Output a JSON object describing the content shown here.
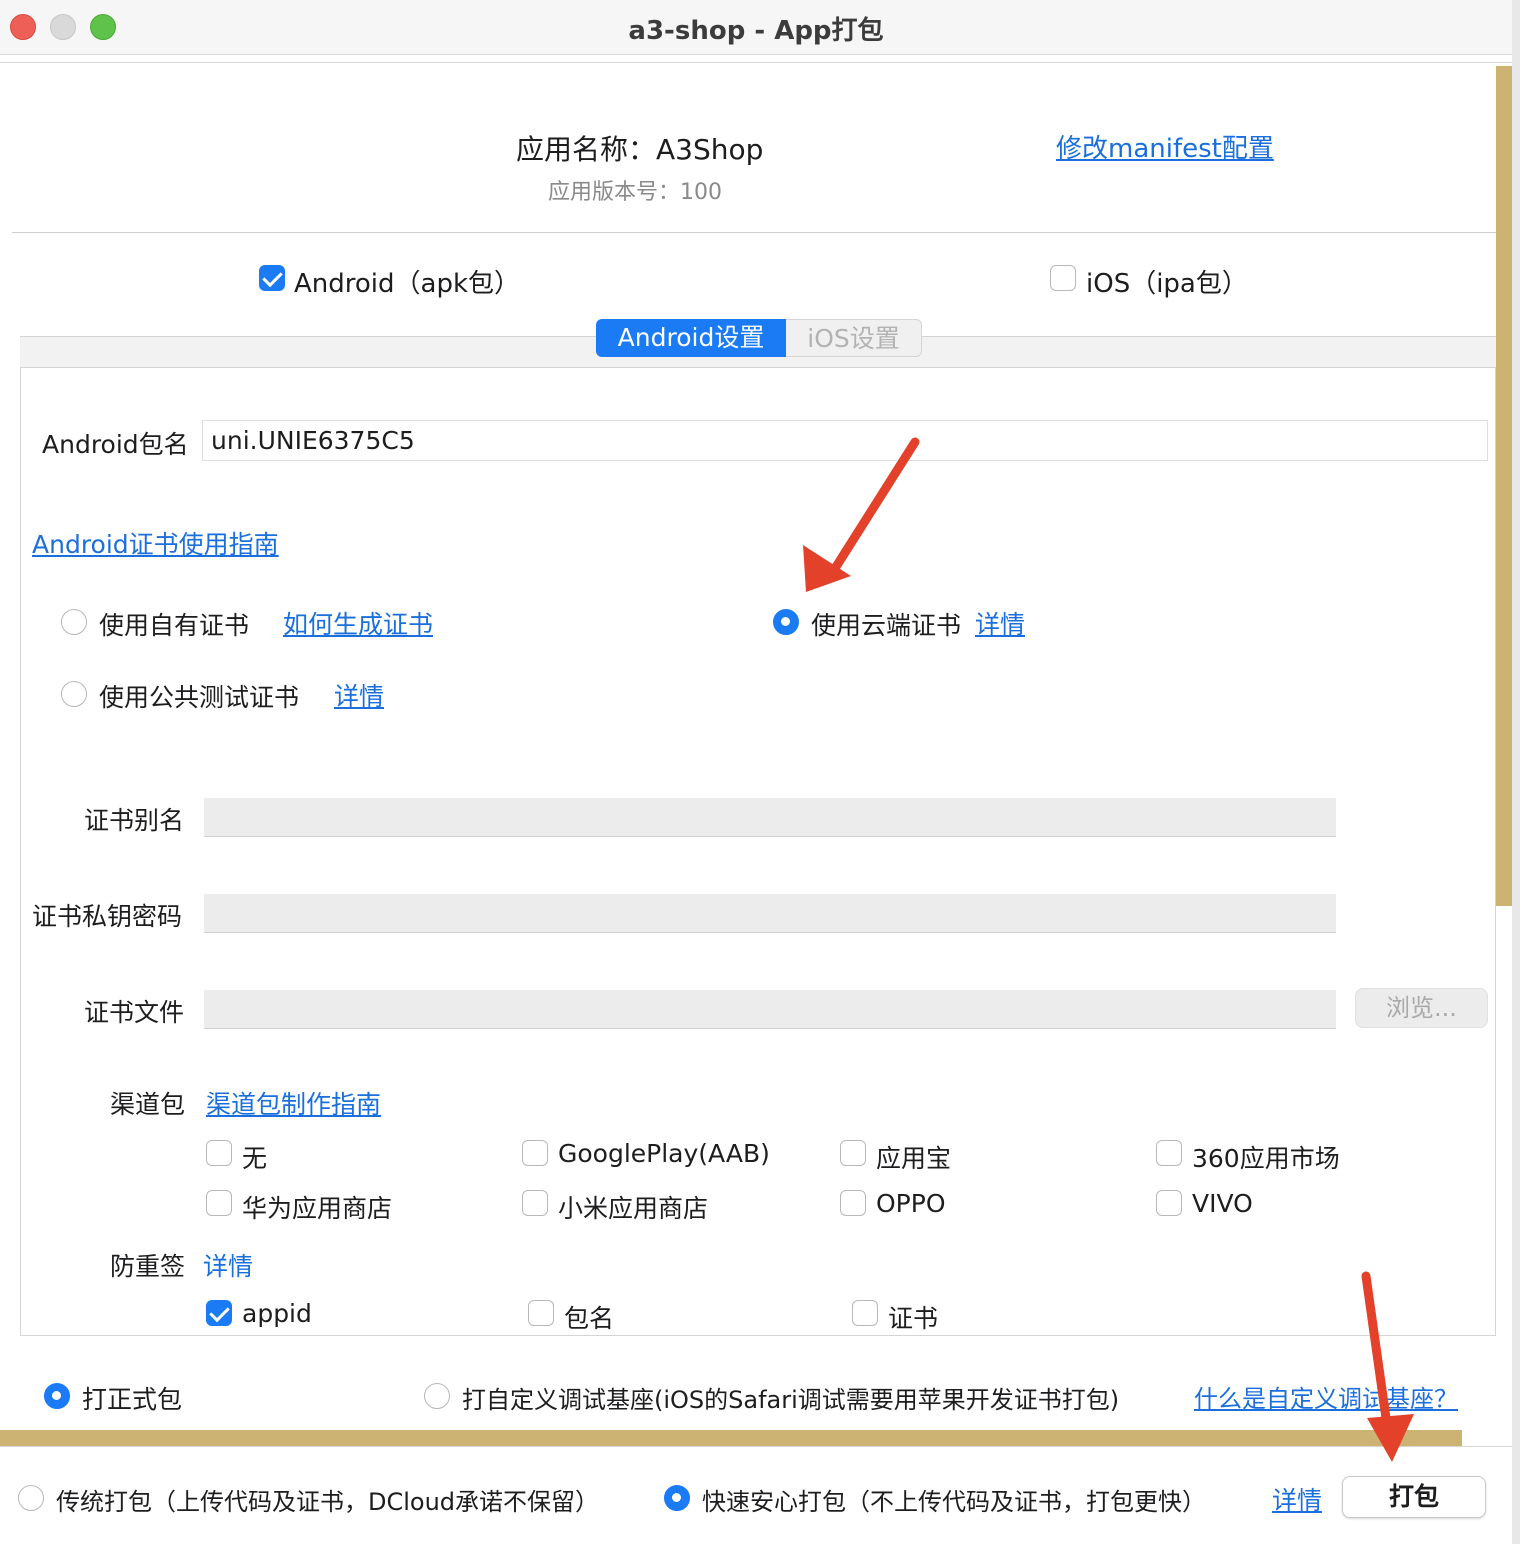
{
  "window": {
    "title": "a3-shop - App打包"
  },
  "header": {
    "app_name": "应用名称：A3Shop",
    "app_version": "应用版本号：100",
    "manifest_link": "修改manifest配置"
  },
  "platforms": {
    "android": {
      "label": "Android（apk包）",
      "checked": true
    },
    "ios": {
      "label": "iOS（ipa包）",
      "checked": false
    }
  },
  "tabs": [
    {
      "label": "Android设置",
      "active": true
    },
    {
      "label": "iOS设置",
      "active": false
    }
  ],
  "android": {
    "package_label": "Android包名",
    "package_value": "uni.UNIE6375C5",
    "cert_guide_link": "Android证书使用指南",
    "cert_options": {
      "own": {
        "label": "使用自有证书",
        "link": "如何生成证书",
        "selected": false
      },
      "cloud": {
        "label": "使用云端证书",
        "link": "详情",
        "selected": true
      },
      "public": {
        "label": "使用公共测试证书",
        "link": "详情",
        "selected": false
      }
    },
    "alias_label": "证书别名",
    "password_label": "证书私钥密码",
    "file_label": "证书文件",
    "browse_button": "浏览...",
    "channel_label": "渠道包",
    "channel_guide_link": "渠道包制作指南",
    "channels": [
      {
        "label": "无",
        "checked": false
      },
      {
        "label": "GooglePlay(AAB)",
        "checked": false
      },
      {
        "label": "应用宝",
        "checked": false
      },
      {
        "label": "360应用市场",
        "checked": false
      },
      {
        "label": "华为应用商店",
        "checked": false
      },
      {
        "label": "小米应用商店",
        "checked": false
      },
      {
        "label": "OPPO",
        "checked": false
      },
      {
        "label": "VIVO",
        "checked": false
      }
    ],
    "anti_resign_label": "防重签",
    "anti_resign_link": "详情",
    "anti_resign_options": [
      {
        "label": "appid",
        "checked": true
      },
      {
        "label": "包名",
        "checked": false
      },
      {
        "label": "证书",
        "checked": false
      }
    ]
  },
  "build_type": {
    "release": {
      "label": "打正式包",
      "selected": true
    },
    "custom_base": {
      "label": "打自定义调试基座(iOS的Safari调试需要用苹果开发证书打包)",
      "selected": false
    },
    "custom_base_link": "什么是自定义调试基座？"
  },
  "pack_mode": {
    "traditional": {
      "label": "传统打包（上传代码及证书，DCloud承诺不保留）",
      "selected": false
    },
    "fast": {
      "label": "快速安心打包（不上传代码及证书，打包更快）",
      "selected": true
    },
    "detail_link": "详情",
    "pack_button": "打包"
  },
  "colors": {
    "accent": "#1a7bf5",
    "link": "#1a6fdc",
    "annotation_arrow": "#e4412b",
    "scrollbar": "#cdb373"
  }
}
